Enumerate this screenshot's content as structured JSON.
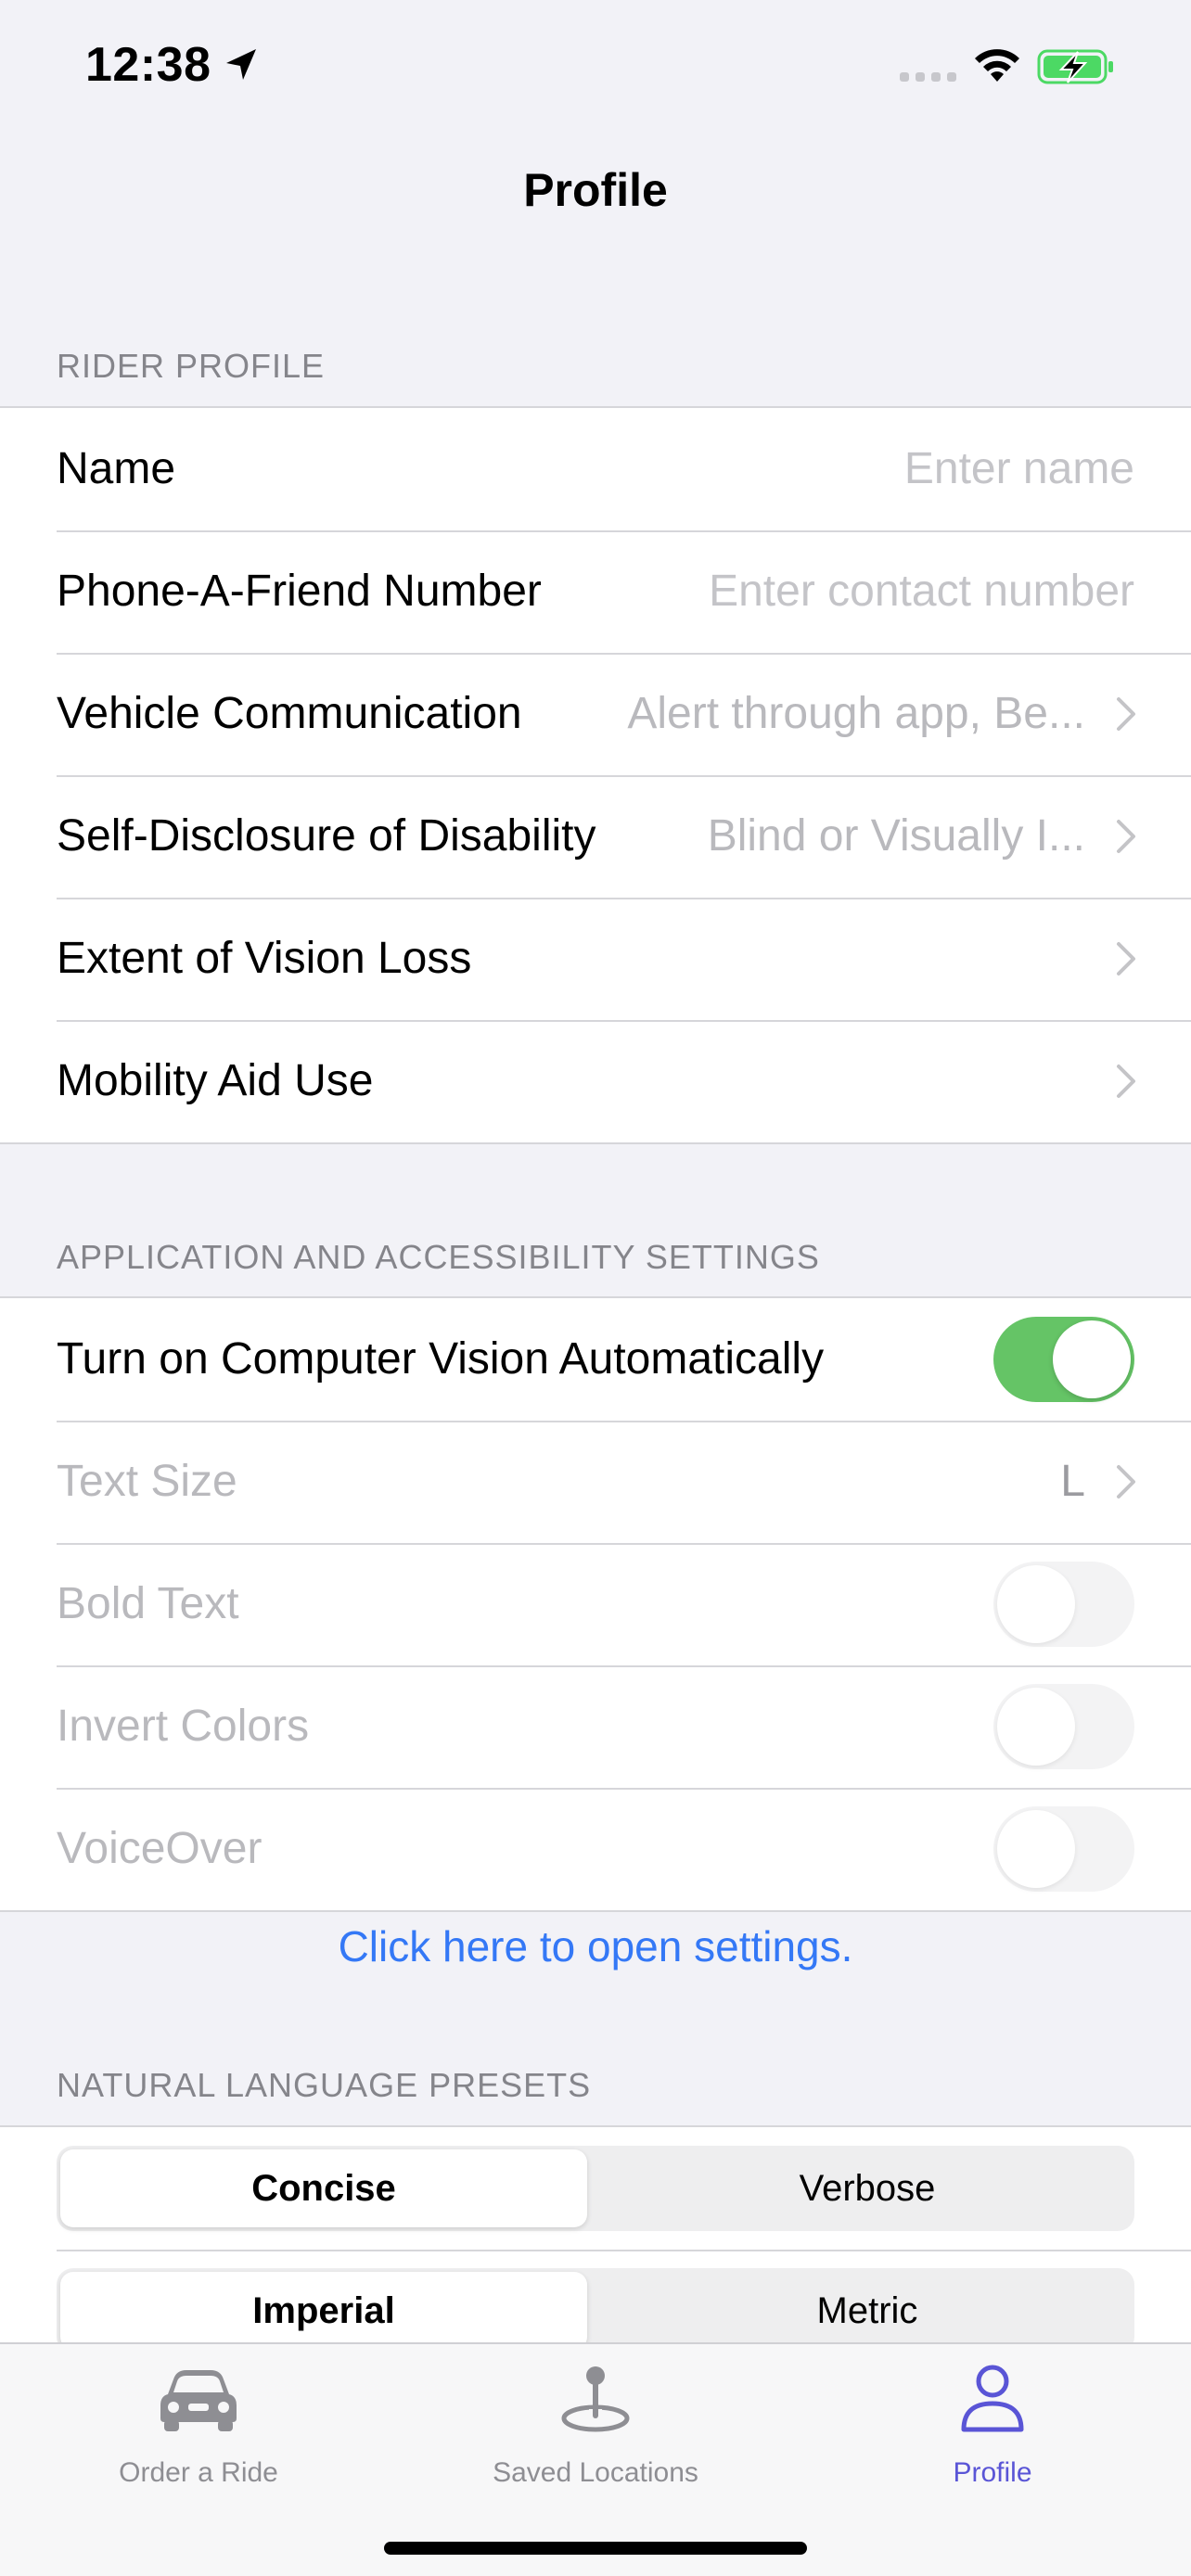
{
  "status_bar": {
    "time": "12:38",
    "icons": [
      "location-arrow-icon",
      "cellular-signal-icon",
      "wifi-icon",
      "battery-charging-icon"
    ],
    "battery_color": "#4cd964"
  },
  "nav": {
    "title": "Profile"
  },
  "rider_profile": {
    "header": "RIDER PROFILE",
    "name_label": "Name",
    "name_placeholder": "Enter name",
    "phone_label": "Phone-A-Friend Number",
    "phone_placeholder": "Enter contact number",
    "vehicle_label": "Vehicle Communication",
    "vehicle_value": "Alert through app, Be...",
    "disclosure_label": "Self-Disclosure of Disability",
    "disclosure_value": "Blind or Visually I...",
    "vision_label": "Extent of Vision Loss",
    "mobility_label": "Mobility Aid Use"
  },
  "accessibility": {
    "header": "APPLICATION AND ACCESSIBILITY SETTINGS",
    "computer_vision_label": "Turn on Computer Vision Automatically",
    "computer_vision_on": true,
    "text_size_label": "Text Size",
    "text_size_value": "L",
    "bold_text_label": "Bold Text",
    "bold_text_on": false,
    "invert_colors_label": "Invert Colors",
    "invert_colors_on": false,
    "voiceover_label": "VoiceOver",
    "voiceover_on": false,
    "toggle_on_color": "#65c466",
    "settings_link": "Click here to open settings."
  },
  "presets": {
    "header": "NATURAL LANGUAGE PRESETS",
    "verbosity": {
      "options": [
        "Concise",
        "Verbose"
      ],
      "selected": "Concise"
    },
    "units": {
      "options": [
        "Imperial",
        "Metric"
      ],
      "selected": "Imperial"
    }
  },
  "tab_bar": {
    "tabs": [
      {
        "label": "Order a Ride",
        "icon": "car-icon",
        "active": false
      },
      {
        "label": "Saved Locations",
        "icon": "map-pin-icon",
        "active": false
      },
      {
        "label": "Profile",
        "icon": "person-icon",
        "active": true
      }
    ],
    "active_color": "#5a55d6"
  },
  "link_color": "#3478f6"
}
